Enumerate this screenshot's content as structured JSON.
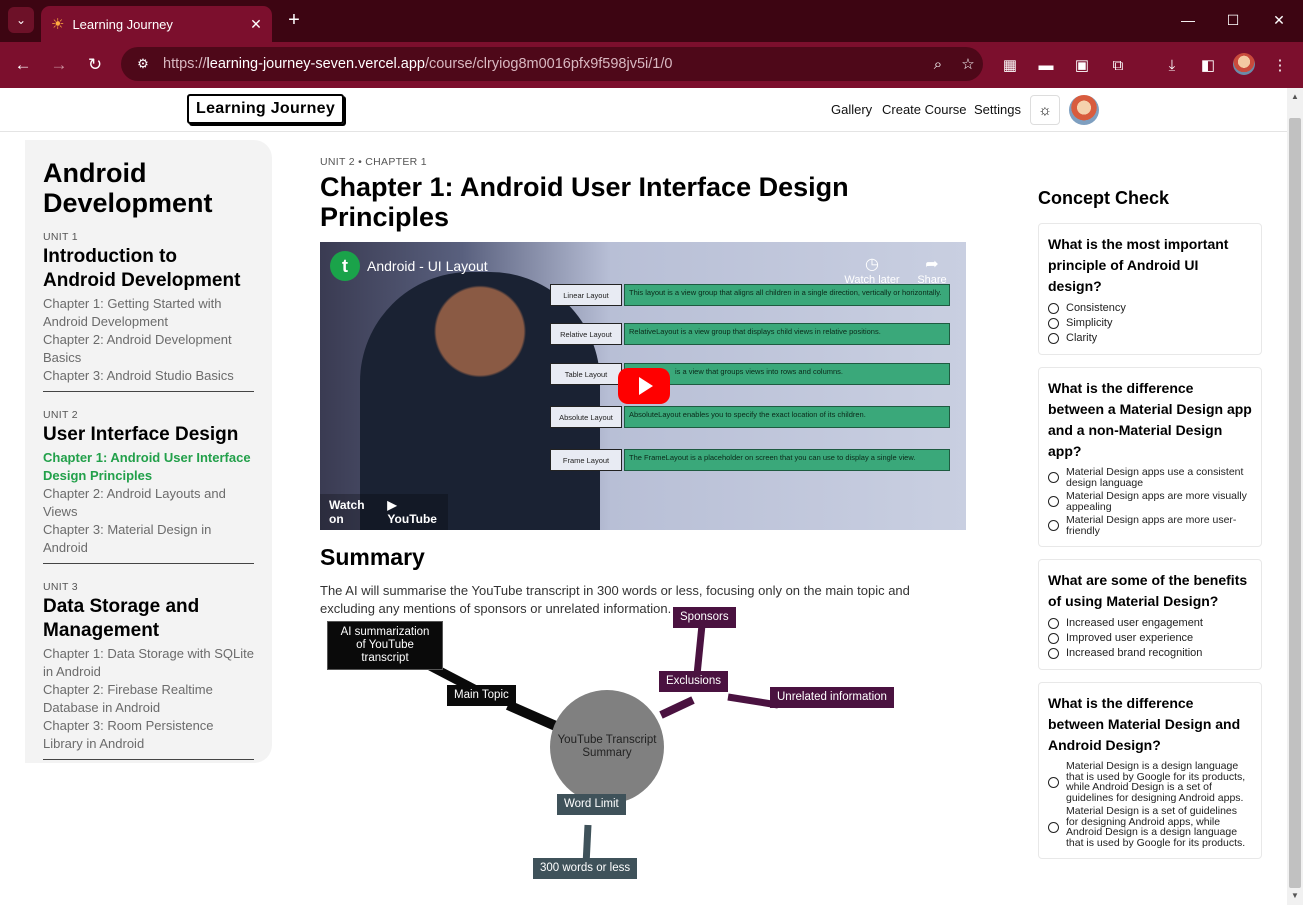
{
  "browser": {
    "tab_title": "Learning Journey",
    "url_prefix": "https://",
    "url_host": "learning-journey-seven.vercel.app",
    "url_path": "/course/clryiog8m0016pfx9f598jv5i/1/0"
  },
  "header": {
    "logo": "Learning Journey",
    "links": {
      "gallery": "Gallery",
      "create": "Create Course",
      "settings": "Settings"
    }
  },
  "sidebar": {
    "course_title": "Android Development",
    "units": [
      {
        "label": "UNIT 1",
        "title": "Introduction to Android Development",
        "chapters": [
          "Chapter 1: Getting Started with Android Development",
          "Chapter 2: Android Development Basics",
          "Chapter 3: Android Studio Basics"
        ]
      },
      {
        "label": "UNIT 2",
        "title": "User Interface Design",
        "chapters": [
          "Chapter 1: Android User Interface Design Principles",
          "Chapter 2: Android Layouts and Views",
          "Chapter 3: Material Design in Android"
        ]
      },
      {
        "label": "UNIT 3",
        "title": "Data Storage and Management",
        "chapters": [
          "Chapter 1: Data Storage with SQLite in Android",
          "Chapter 2: Firebase Realtime Database in Android",
          "Chapter 3: Room Persistence Library in Android"
        ]
      }
    ]
  },
  "main": {
    "breadcrumb": "UNIT 2 • CHAPTER 1",
    "title": "Chapter 1: Android User Interface Design Principles",
    "video": {
      "title": "Android - UI Layout",
      "watch_later": "Watch later",
      "share": "Share",
      "watch_on": "Watch on",
      "youtube": "▶ YouTube",
      "layouts": [
        {
          "name": "Linear Layout",
          "desc": "This layout is a view group that aligns all children in a single direction, vertically or horizontally."
        },
        {
          "name": "Relative Layout",
          "desc": "RelativeLayout is a view group that displays child views in relative positions."
        },
        {
          "name": "Table Layout",
          "desc": "is a view that groups views into rows and columns."
        },
        {
          "name": "Absolute Layout",
          "desc": "AbsoluteLayout enables you to specify the exact location of its children."
        },
        {
          "name": "Frame Layout",
          "desc": "The FrameLayout is a placeholder on screen that you can use to display a single view."
        }
      ]
    },
    "summary_title": "Summary",
    "summary_text": "The AI will summarise the YouTube transcript in 300 words or less, focusing only on the main topic and excluding any mentions of sponsors or unrelated information.",
    "mindmap": {
      "center": "YouTube Transcript Summary",
      "main_topic": "Main Topic",
      "ai_summary": "AI summarization of YouTube transcript",
      "exclusions": "Exclusions",
      "sponsors": "Sponsors",
      "unrelated": "Unrelated information",
      "word_limit": "Word Limit",
      "word_count": "300 words or less",
      "colors": {
        "dark": "#0a0a0a",
        "purple": "#4a1240",
        "slate": "#3f525a",
        "center": "#808080"
      }
    }
  },
  "quiz": {
    "title": "Concept Check",
    "questions": [
      {
        "q": "What is the most important principle of Android UI design?",
        "options": [
          "Consistency",
          "Simplicity",
          "Clarity"
        ]
      },
      {
        "q": "What is the difference between a Material Design app and a non-Material Design app?",
        "options": [
          "Material Design apps use a consistent design language",
          "Material Design apps are more visually appealing",
          "Material Design apps are more user-friendly"
        ]
      },
      {
        "q": "What are some of the benefits of using Material Design?",
        "options": [
          "Increased user engagement",
          "Improved user experience",
          "Increased brand recognition"
        ]
      },
      {
        "q": "What is the difference between Material Design and Android Design?",
        "options": [
          "Material Design is a design language that is used by Google for its products, while Android Design is a set of guidelines for designing Android apps.",
          "Material Design is a set of guidelines for designing Android apps, while Android Design is a design language that is used by Google for its products."
        ]
      }
    ]
  }
}
